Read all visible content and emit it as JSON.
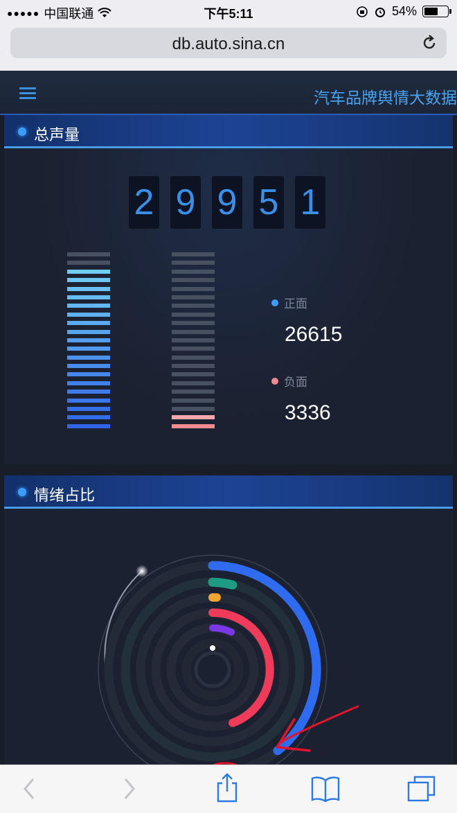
{
  "status_bar": {
    "carrier": "中国联通",
    "signal": "●●●●●",
    "time": "下午5:11",
    "battery": "54%"
  },
  "browser": {
    "url": "db.auto.sina.cn"
  },
  "app": {
    "title": "汽车品牌舆情大数据"
  },
  "volume_panel": {
    "title": "总声量",
    "digits": [
      "2",
      "9",
      "9",
      "5",
      "1"
    ],
    "positive_label": "正面",
    "positive_value": "26615",
    "negative_label": "负面",
    "negative_value": "3336",
    "positive_share": 0.89,
    "negative_share": 0.11
  },
  "emotion_panel": {
    "title": "情绪占比"
  },
  "colors": {
    "accent": "#3d9cff",
    "positive": "#3d9cff",
    "negative": "#f08a93",
    "ring_blue": "#2f6bef",
    "ring_teal": "#1f9b84",
    "ring_orange": "#f2a531",
    "ring_red": "#ef3b5a",
    "ring_purple": "#7a38e6"
  },
  "icons": {
    "menu": "hamburger-menu-icon",
    "reload": "reload-icon",
    "back": "chevron-left-icon",
    "forward": "chevron-right-icon",
    "share": "share-icon",
    "bookmarks": "book-icon",
    "tabs": "tabs-icon"
  }
}
